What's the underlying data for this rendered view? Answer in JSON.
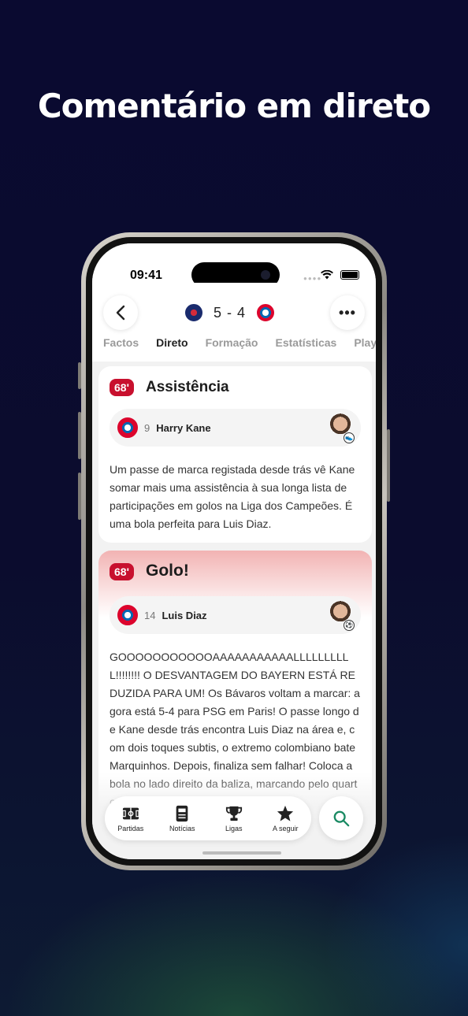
{
  "headline": "Comentário em direto",
  "status_bar": {
    "time": "09:41"
  },
  "match": {
    "score": "5 - 4",
    "home_team_icon": "psg-crest-icon",
    "away_team_icon": "bayern-crest-icon"
  },
  "tabs": [
    {
      "label": "Factos"
    },
    {
      "label": "Direto",
      "active": true
    },
    {
      "label": "Formação"
    },
    {
      "label": "Estatísticas"
    },
    {
      "label": "Playe"
    }
  ],
  "events": [
    {
      "minute": "68'",
      "title": "Assistência",
      "player_number": "9",
      "player_name": "Harry Kane",
      "text": "Um passe de marca registada desde trás vê Kane somar mais uma assistência à sua longa lista de participações em golos na Liga dos Campeões. É uma bola perfeita para Luis Diaz."
    },
    {
      "minute": "68'",
      "title": "Golo!",
      "player_number": "14",
      "player_name": "Luis Diaz",
      "text": "GOOOOOOOOOOOAAAAAAAAAAALLLLLLLLLL!!!!!!!! O DESVANTAGEM DO BAYERN ESTÁ REDUZIDA PARA UM! Os Bávaros voltam a marcar: agora está 5-4 para PSG em Paris! O passe longo de Kane desde trás encontra Luis Diaz na área e, com dois toques subtis, o extremo colombiano bate Marquinhos. Depois, finaliza sem falhar! Coloca a bola no lado direito da baliza, marcando pelo quarto jogo"
    }
  ],
  "nav": [
    {
      "label": "Partidas",
      "icon": "pitch-icon"
    },
    {
      "label": "Notícias",
      "icon": "news-icon"
    },
    {
      "label": "Ligas",
      "icon": "trophy-icon"
    },
    {
      "label": "A seguir",
      "icon": "star-icon"
    }
  ],
  "colors": {
    "accent_red": "#c8102e",
    "background": "#0a0a30",
    "search_green": "#1a8a63"
  }
}
